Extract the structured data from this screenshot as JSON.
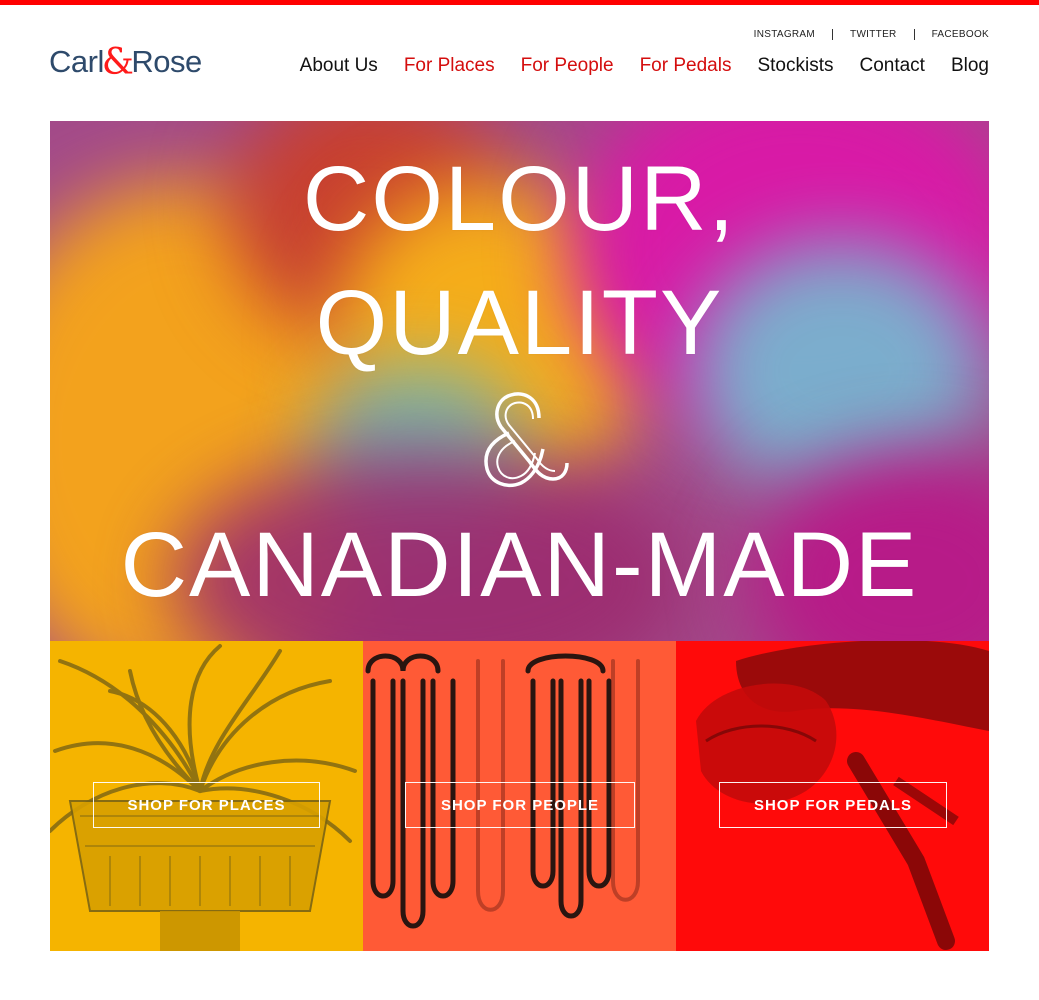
{
  "brand": {
    "name_left": "Carl",
    "name_amp": "&",
    "name_right": "Rose"
  },
  "social": [
    "INSTAGRAM",
    "TWITTER",
    "FACEBOOK"
  ],
  "nav": [
    {
      "label": "About Us",
      "color": "#111111"
    },
    {
      "label": "For Places",
      "color": "#d40e0e"
    },
    {
      "label": "For People",
      "color": "#d40e0e"
    },
    {
      "label": "For Pedals",
      "color": "#d40e0e"
    },
    {
      "label": "Stockists",
      "color": "#111111"
    },
    {
      "label": "Contact",
      "color": "#111111"
    },
    {
      "label": "Blog",
      "color": "#111111"
    }
  ],
  "hero": {
    "line1": "COLOUR,",
    "line2": "QUALITY",
    "line3": "CANADIAN-MADE",
    "amp": "&"
  },
  "tiles": [
    {
      "label": "SHOP FOR PLACES",
      "color": "#f5b400"
    },
    {
      "label": "SHOP FOR PEOPLE",
      "color": "#ff5a36"
    },
    {
      "label": "SHOP FOR PEDALS",
      "color": "#ff0a0a"
    }
  ],
  "colors": {
    "accent": "#ff0000",
    "logo_text": "#2e4a6b"
  }
}
